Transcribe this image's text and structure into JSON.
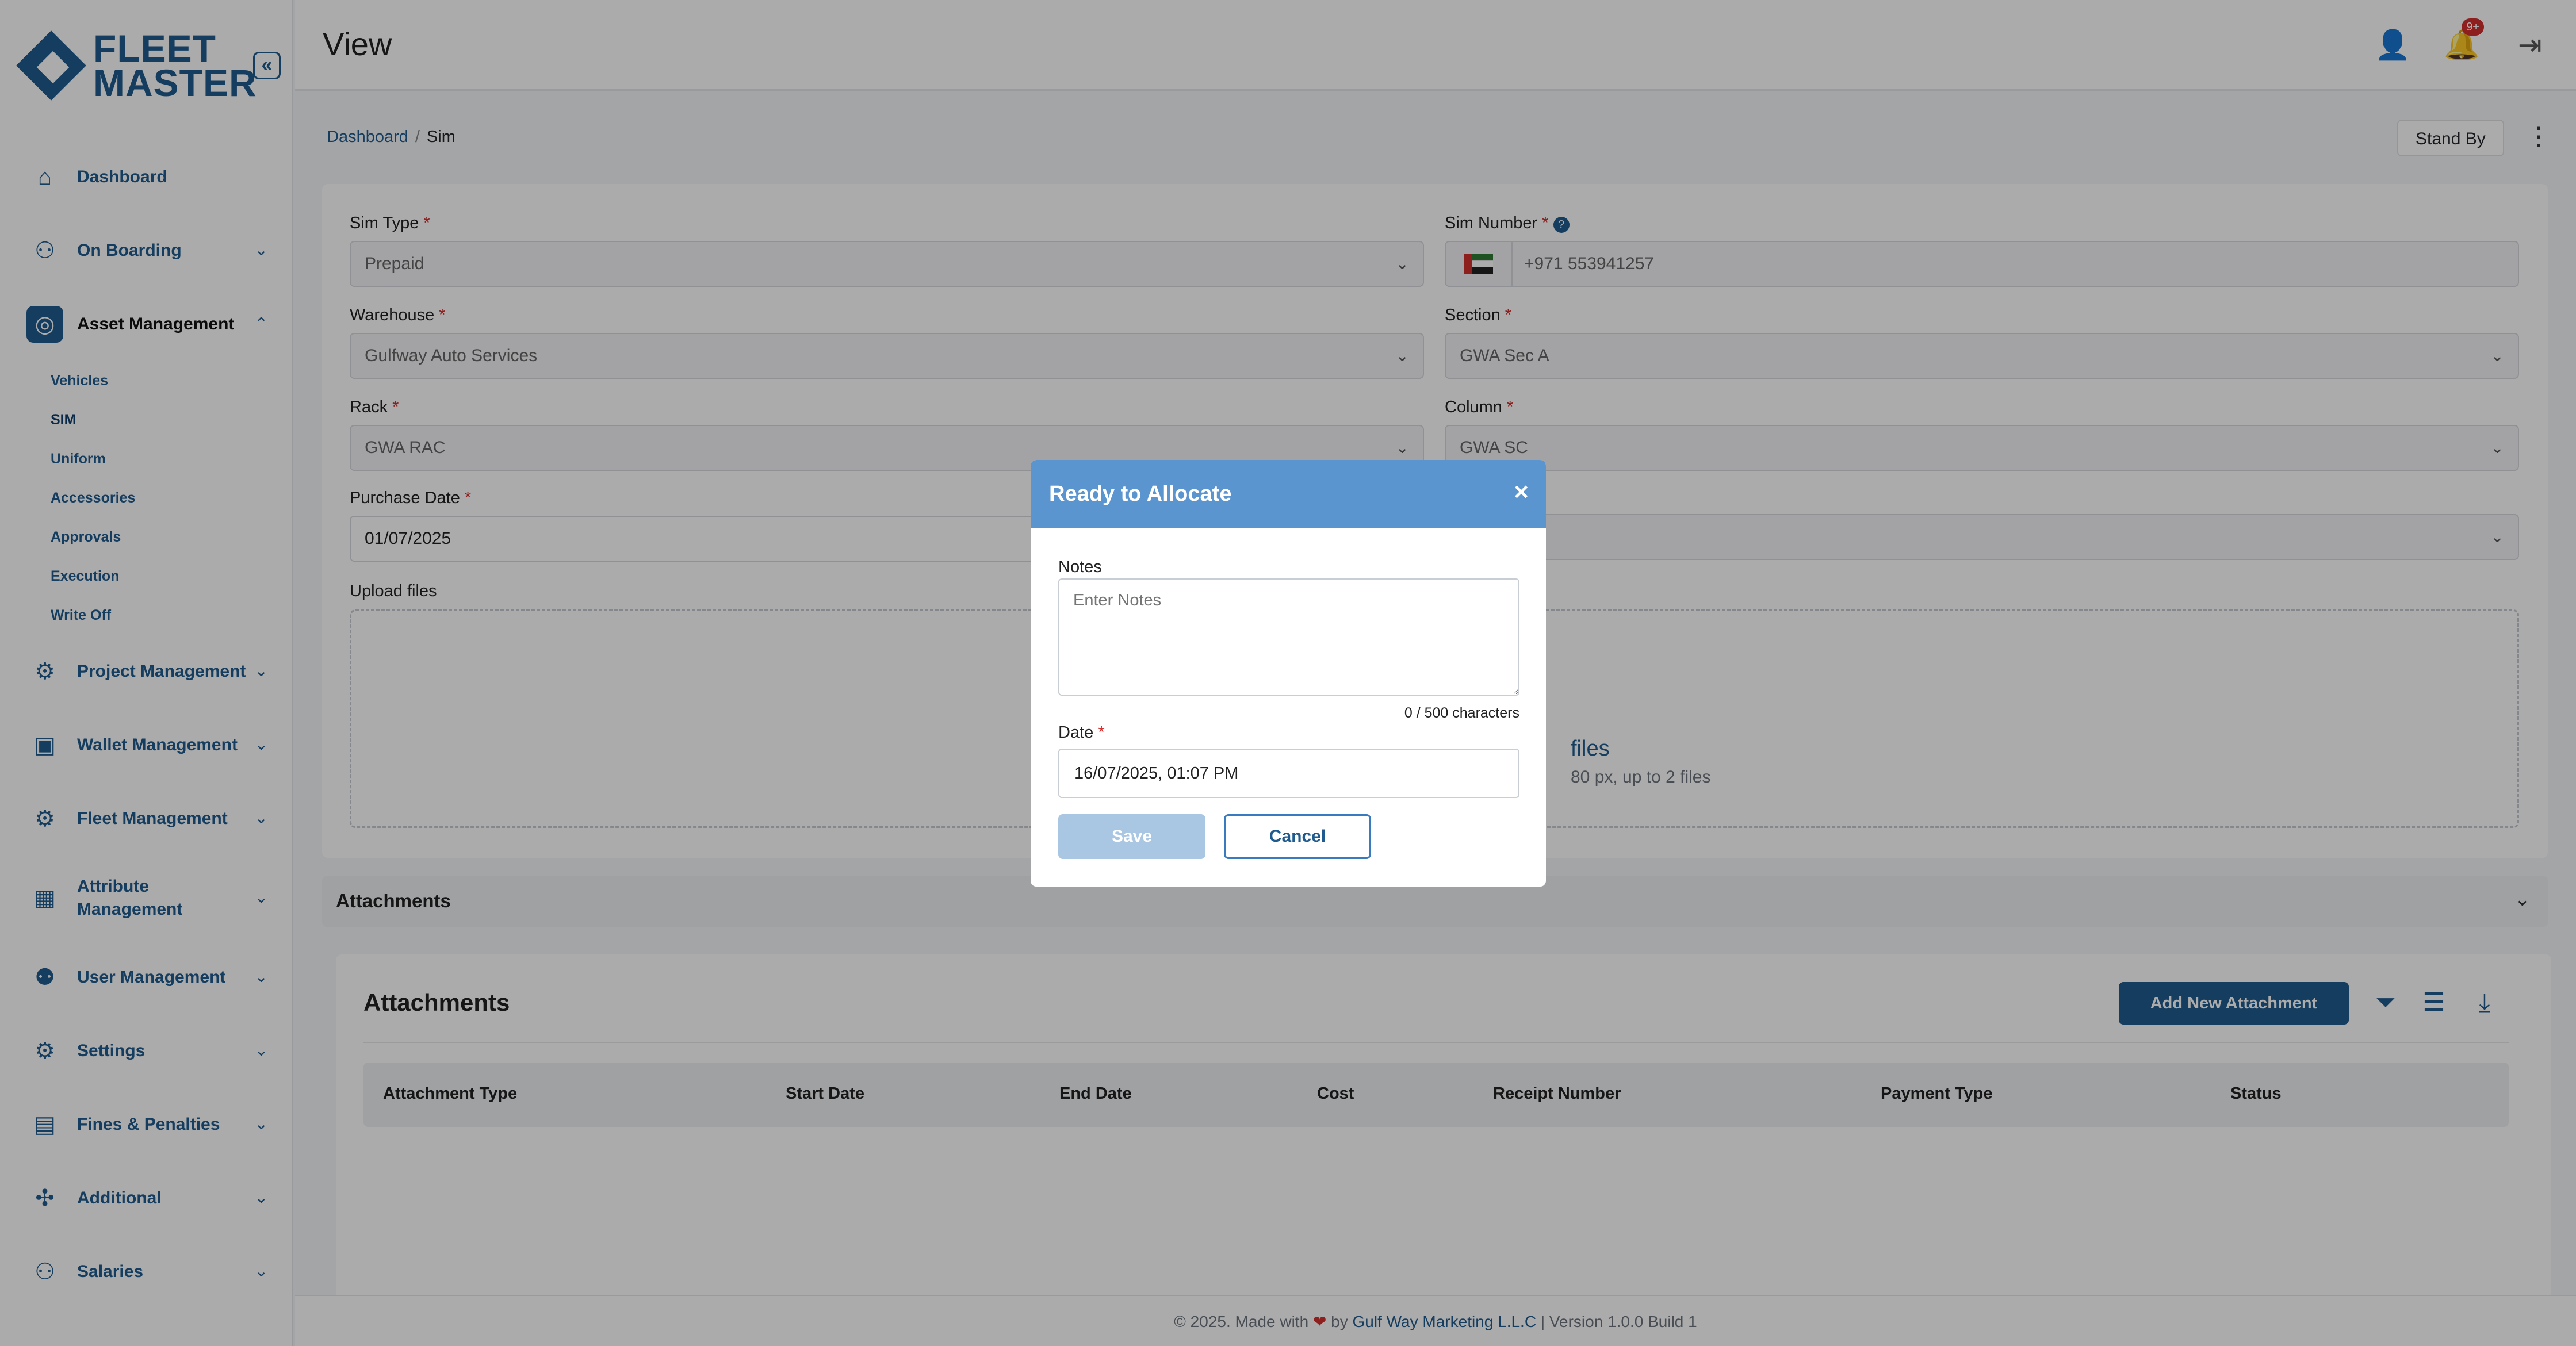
{
  "brand": {
    "line1": "FLEET",
    "line2": "MASTER",
    "collapse_glyph": "«",
    "color": "#1f5b8f"
  },
  "sidebar": {
    "items": [
      {
        "label": "Dashboard",
        "icon": "home-icon"
      },
      {
        "label": "On Boarding",
        "icon": "onboarding-icon"
      },
      {
        "label": "Asset Management",
        "icon": "asset-icon"
      },
      {
        "label": "Project Management",
        "icon": "project-icon"
      },
      {
        "label": "Wallet Management",
        "icon": "wallet-icon"
      },
      {
        "label": "Fleet Management",
        "icon": "fleet-icon"
      },
      {
        "label": "Attribute Management",
        "icon": "attribute-icon"
      },
      {
        "label": "User Management",
        "icon": "users-icon"
      },
      {
        "label": "Settings",
        "icon": "gear-icon"
      },
      {
        "label": "Fines & Penalties",
        "icon": "fines-icon"
      },
      {
        "label": "Additional",
        "icon": "additional-icon"
      },
      {
        "label": "Salaries",
        "icon": "salaries-icon"
      }
    ],
    "asset_sub": [
      "Vehicles",
      "SIM",
      "Uniform",
      "Accessories",
      "Approvals",
      "Execution",
      "Write Off"
    ]
  },
  "header": {
    "title": "View",
    "notification_count": "9+"
  },
  "breadcrumb": {
    "home": "Dashboard",
    "current": "Sim",
    "separator": "/"
  },
  "status_button": "Stand By",
  "form": {
    "sim_type": {
      "label": "Sim Type",
      "value": "Prepaid"
    },
    "sim_number": {
      "label": "Sim Number",
      "value": "+971 553941257"
    },
    "warehouse": {
      "label": "Warehouse",
      "value": "Gulfway Auto Services"
    },
    "section": {
      "label": "Section",
      "value": "GWA Sec A"
    },
    "rack": {
      "label": "Rack",
      "value": "GWA RAC"
    },
    "column": {
      "label": "Column",
      "value": "GWA SC"
    },
    "purchase_date": {
      "label": "Purchase Date",
      "value": "01/07/2025"
    },
    "upload_label": "Upload files",
    "upload_main": "files",
    "upload_sub": "80 px, up to 2 files"
  },
  "accordion_title": "Attachments",
  "attachments": {
    "title": "Attachments",
    "add_button": "Add New Attachment",
    "columns": [
      "Attachment Type",
      "Start Date",
      "End Date",
      "Cost",
      "Receipt Number",
      "Payment Type",
      "Status"
    ]
  },
  "footer": {
    "prefix": "© 2025. Made with",
    "by": "by",
    "company": "Gulf Way Marketing L.L.C",
    "suffix": "| Version 1.0.0 Build 1"
  },
  "modal": {
    "title": "Ready to Allocate",
    "notes_label": "Notes",
    "notes_placeholder": "Enter Notes",
    "counter": "0 / 500 characters",
    "date_label": "Date",
    "date_value": "16/07/2025, 01:07 PM",
    "save": "Save",
    "cancel": "Cancel"
  }
}
